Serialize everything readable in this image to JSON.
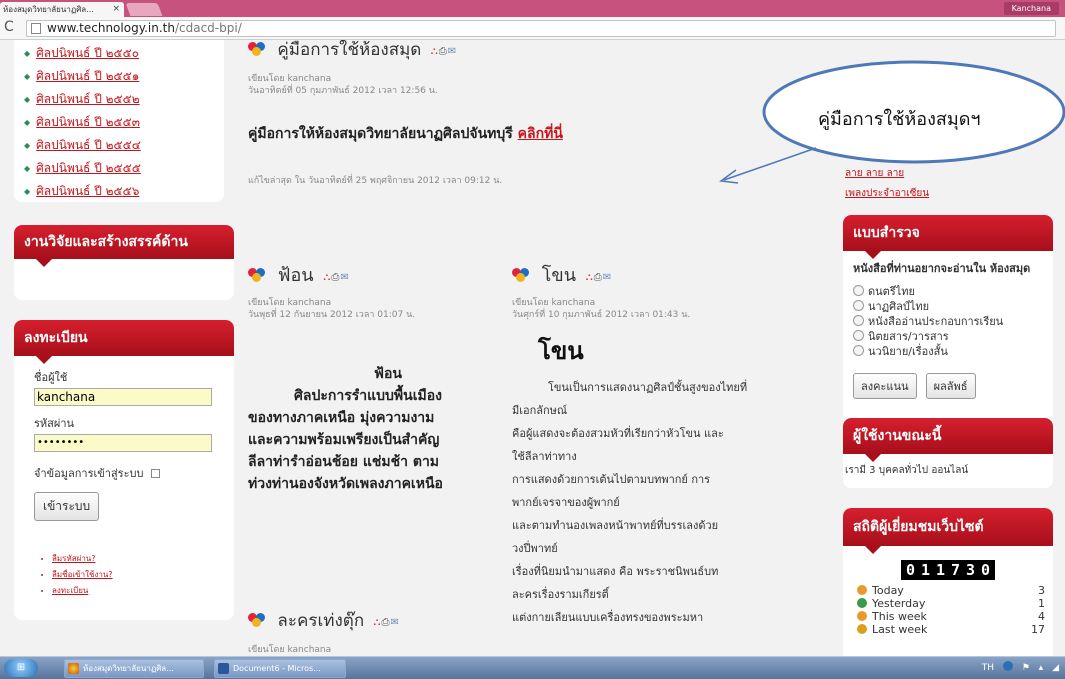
{
  "browser": {
    "tab_title": "ห้องสมุดวิทยาลัยนาฏศิล...",
    "tab_close": "×",
    "profile": "Kanchana",
    "url_host": "www.technology.in.th",
    "url_path": "/cdacd-bpi/"
  },
  "years": [
    "ศิลปนิพนธ์ ปี ๒๕๕๐",
    "ศิลปนิพนธ์ ปี ๒๕๕๑",
    "ศิลปนิพนธ์ ปี ๒๕๕๒",
    "ศิลปนิพนธ์ ปี ๒๕๕๓",
    "ศิลปนิพนธ์ ปี ๒๕๕๔",
    "ศิลปนิพนธ์ ปี ๒๕๕๕",
    "ศิลปนิพนธ์ ปี ๒๕๕๖"
  ],
  "research_box": {
    "title": "งานวิจัยและสร้างสรรค์ด้าน"
  },
  "login": {
    "title": "ลงทะเบียน",
    "username_label": "ชื่อผู้ใช้",
    "username_value": "kanchana",
    "password_label": "รหัสผ่าน",
    "password_value": "••••••••",
    "remember_label": "จำข้อมูลการเข้าสู่ระบบ",
    "submit": "เข้าระบบ",
    "links": [
      "ลืมรหัสผ่าน?",
      "ลืมชื่อเข้าใช้งาน?",
      "ลงทะเบียน"
    ]
  },
  "manual_article": {
    "title": "คู่มือการใช้ห้องสมุด",
    "author": "เขียนโดย kanchana",
    "date": "วันอาทิตย์ที่ 05 กุมภาพันธ์ 2012 เวลา 12:56 น.",
    "body_text": "คู่มือการให้ห้องสมุดวิทยาลัยนาฏศิลปจันทบุรี",
    "body_link": "คลิกที่นี่",
    "modified": "แก้ไขล่าสุด ใน วันอาทิตย์ที่ 25 พฤศจิกายน 2012 เวลา 09:12 น."
  },
  "callout": {
    "text": "คู่มือการใช้ห้องสมุดฯ"
  },
  "fon_article": {
    "title": "ฟ้อน",
    "author": "เขียนโดย kanchana",
    "date": "วันพุธที่ 12 กันยายน 2012 เวลา 01:07 น.",
    "heading": "ฟ้อน",
    "lines": [
      "ศิลปะการรำแบบพื้นเมือง",
      "ของทางภาคเหนือ มุ่งความงาม",
      "และความพร้อมเพรียงเป็นสำคัญ",
      "ลีลาท่ารำอ่อนช้อย แช่มช้า ตาม",
      "ท่วงท่านองจังหวัดเพลงภาคเหนือ"
    ]
  },
  "khon_article": {
    "title": "โขน",
    "author": "เขียนโดย kanchana",
    "date": "วันศุกร์ที่ 10 กุมภาพันธ์ 2012 เวลา 01:43 น.",
    "heading": "โขน",
    "paragraphs": [
      "โขนเป็นการแสดงนาฏศิลป์ชั้นสูงของไทยที่",
      "มีเอกลักษณ์",
      "คือผู้แสดงจะต้องสวมหัวที่เรียกว่าหัวโขน และ",
      "ใช้ลีลาท่าทาง",
      "การแสดงด้วยการเต้นไปตามบทพากย์ การ",
      "พากย์เจรจาของผู้พากย์",
      "และตามทำนองเพลงหน้าพาทย์ที่บรรเลงด้วย",
      "วงปี่พาทย์",
      "เรื่องที่นิยมนำมาแสดง คือ พระราชนิพนธ์บท",
      "ละครเรื่องรามเกียรติ์",
      "แต่งกายเลียนแบบเครื่องทรงของพระมหา"
    ]
  },
  "lakhon_article": {
    "title": "ละครเท่งตุ๊ก",
    "author": "เขียนโดย kanchana"
  },
  "right_links": [
    "ลาย ลาย ลาย",
    "เพลงประจำอาเซียน"
  ],
  "poll": {
    "title": "แบบสำรวจ",
    "question": "หนังสือที่ท่านอยากจะอ่านใน ห้องสมุด",
    "options": [
      "ดนตรีไทย",
      "นาฏศิลป์ไทย",
      "หนังสืออ่านประกอบการเรียน",
      "นิตยสาร/วารสาร",
      "นวนิยาย/เรื่องสั้น"
    ],
    "vote": "ลงคะแนน",
    "results": "ผลลัพธ์"
  },
  "online": {
    "title": "ผู้ใช้งานขณะนี้",
    "text": "เรามี 3 บุคคลทั่วไป ออนไลน์"
  },
  "stats": {
    "title": "สถิติผู้เยี่ยมชมเว็บไซต์",
    "counter": [
      "0",
      "1",
      "1",
      "7",
      "3",
      "0"
    ],
    "rows": [
      {
        "label": "Today",
        "value": "3",
        "color": "#e89a2c"
      },
      {
        "label": "Yesterday",
        "value": "1",
        "color": "#3a9a4a"
      },
      {
        "label": "This week",
        "value": "4",
        "color": "#e89a2c"
      },
      {
        "label": "Last week",
        "value": "17",
        "color": "#d8a020"
      }
    ]
  },
  "taskbar": {
    "start": "⊞",
    "tasks": [
      "ห้องสมุดวิทยาลัยนาฏศิล...",
      "Document6 - Micros..."
    ],
    "tray": "TH"
  }
}
